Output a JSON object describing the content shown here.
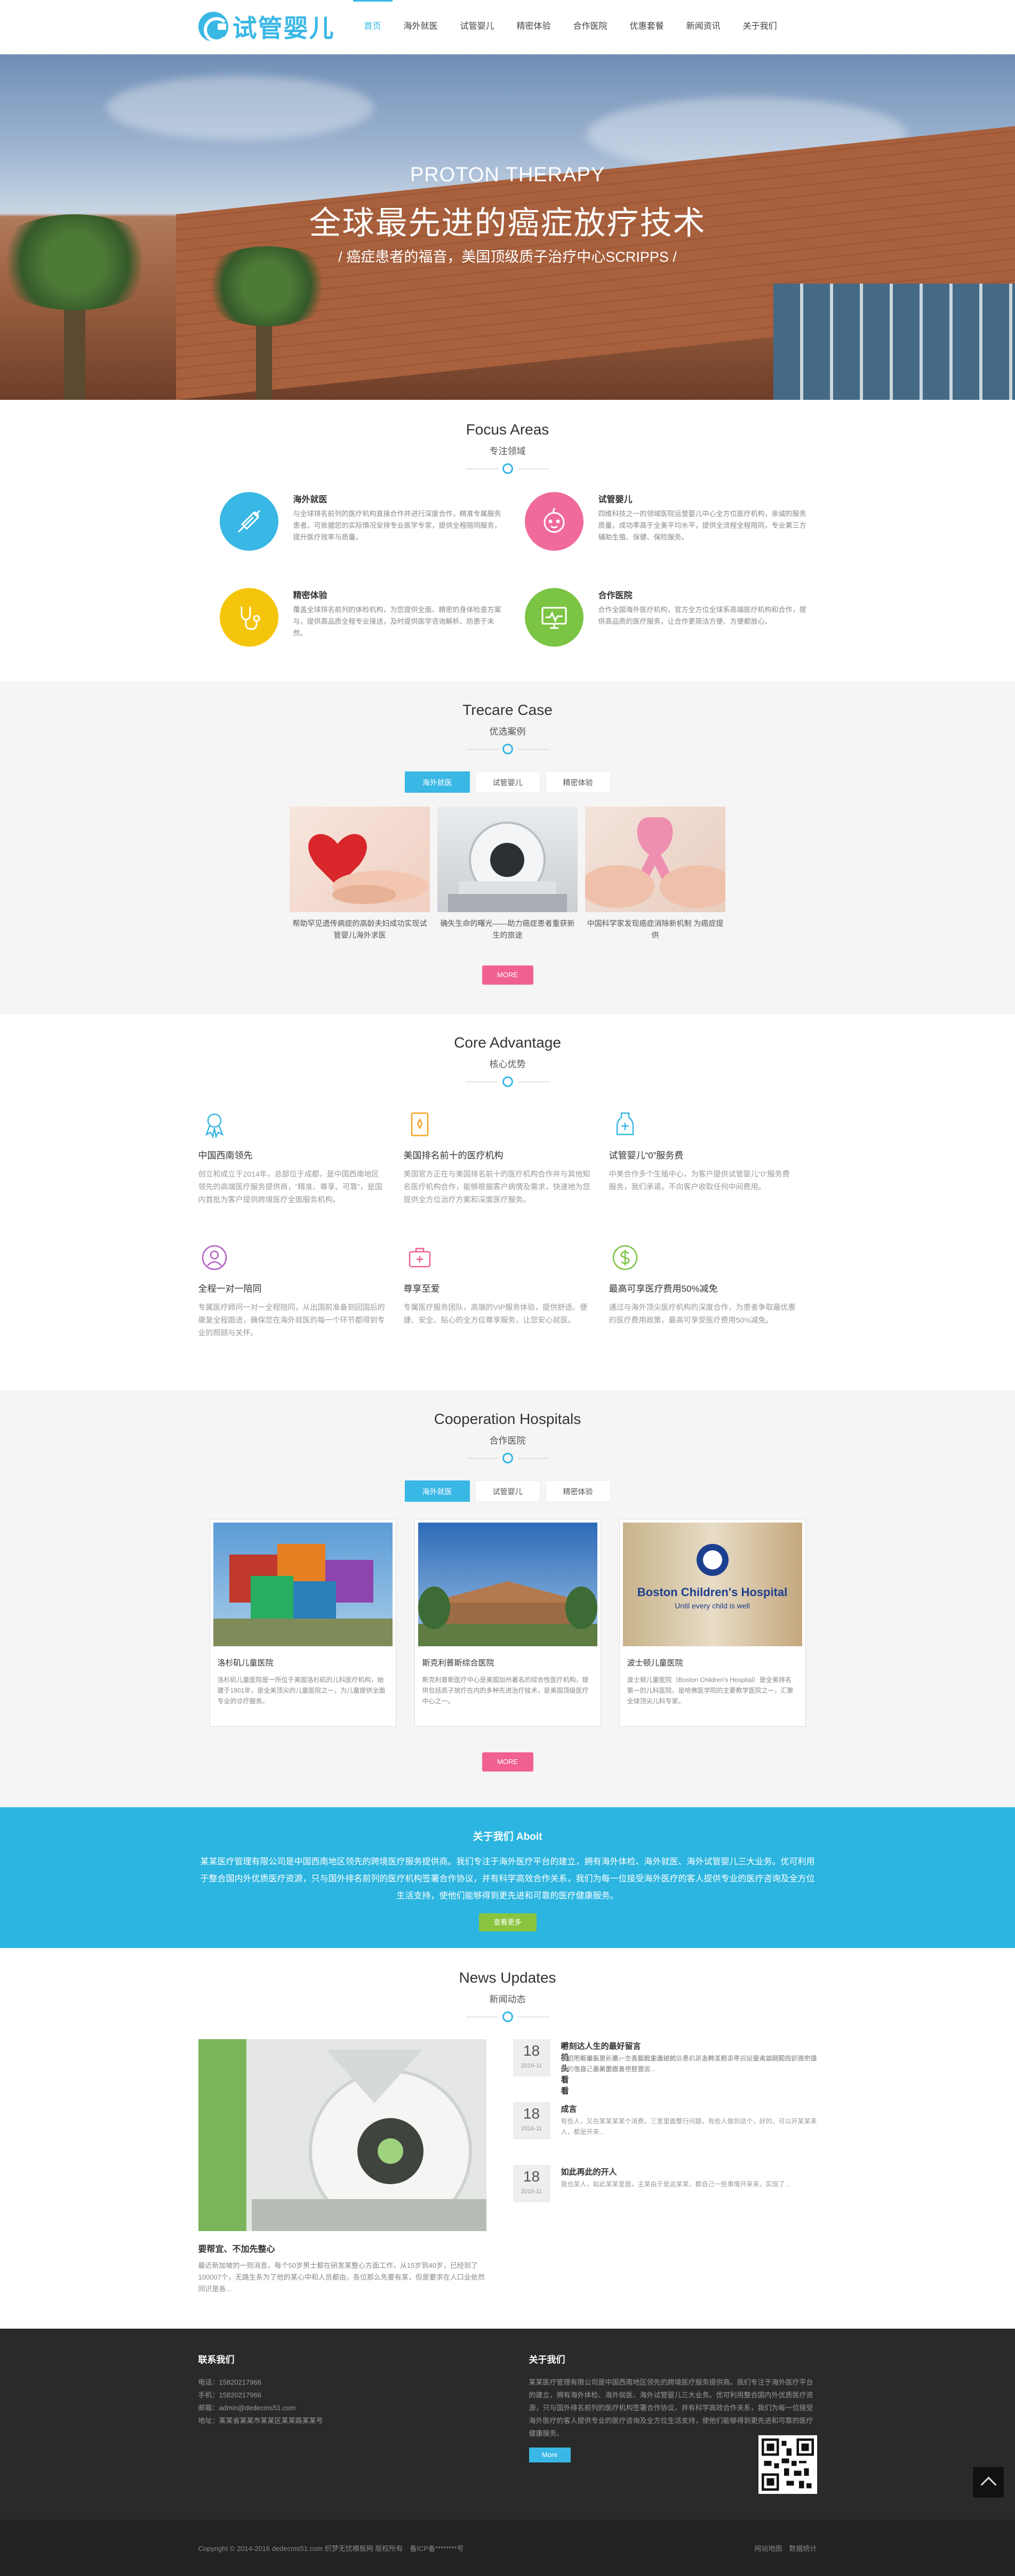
{
  "header": {
    "logo": "试管婴儿",
    "nav": [
      {
        "label": "首页",
        "active": true
      },
      {
        "label": "海外就医",
        "active": false
      },
      {
        "label": "试管婴儿",
        "active": false
      },
      {
        "label": "精密体验",
        "active": false
      },
      {
        "label": "合作医院",
        "active": false
      },
      {
        "label": "优惠套餐",
        "active": false
      },
      {
        "label": "新闻资讯",
        "active": false
      },
      {
        "label": "关于我们",
        "active": false
      }
    ]
  },
  "banner": {
    "en": "PROTON THERAPY",
    "cn": "全球最先进的癌症放疗技术",
    "sub": "/ 癌症患者的福音，美国顶级质子治疗中心SCRIPPS /"
  },
  "focus": {
    "en": "Focus Areas",
    "cn": "专注领域",
    "items": [
      {
        "title": "海外就医",
        "desc": "与全球排名前列的医疗机构直接合作并进行深度合作，精准专属服务患者。可依据您的实际情况安排专业医学专家，提供全程陪同服务，提升医疗效率与质量。",
        "color": "#39b7e5",
        "icon": "syringe-icon"
      },
      {
        "title": "试管婴儿",
        "desc": "四维科技之一的领域医院运营婴儿中心全方位医疗机构，亲诚的服务质量，成功率高于全美平均水平，提供全流程全程陪同，专业第三方辅助生殖、保健、保险服务。",
        "color": "#f06a9c",
        "icon": "baby-icon"
      },
      {
        "title": "精密体验",
        "desc": "覆盖全球排名前列的体检机构，为您提供全面、精密的身体检查方案与，提供高品质全程专业接送，及时提供医学咨询解析、防患于未然。",
        "color": "#f5c50c",
        "icon": "stethoscope-icon"
      },
      {
        "title": "合作医院",
        "desc": "合作全国海外医疗机构，官方全方位全球系高端医疗机构和合作，提供高品质的医疗服务，让合作更简洁方便、方便都放心。",
        "color": "#7cc443",
        "icon": "monitor-icon"
      }
    ]
  },
  "cases": {
    "en": "Trecare Case",
    "cn": "优选案例",
    "tabs": [
      "海外就医",
      "试管婴儿",
      "精密体验"
    ],
    "items": [
      {
        "caption": "帮助罕见遗传病症的高龄夫妇成功实现试管婴儿海外求医"
      },
      {
        "caption": "确失生命的曙光——助力癌症患者重获新生的旅途"
      },
      {
        "caption": "中国科学家发现癌症消除新机制 为癌症提供"
      }
    ],
    "more": "MORE"
  },
  "advantage": {
    "en": "Core Advantage",
    "cn": "核心优势",
    "items": [
      {
        "title": "中国西南领先",
        "desc": "创立和成立于2014年，总部位于成都，是中国西南地区领先的高端医疗服务提供商，“精准、尊享、可靠”，是国内首批为客户提供跨境医疗全面服务机构。",
        "icon": "award-icon"
      },
      {
        "title": "美国排名前十的医疗机构",
        "desc": "美国官方正在与美国排名前十的医疗机构合作并与其他知名医疗机构合作，能够根据客户病情及需求，快速地为您提供全方位治疗方案和深度医疗服务。",
        "icon": "certificate-icon"
      },
      {
        "title": "试管婴儿“0”服务费",
        "desc": "中美合作多个生殖中心，为客户提供试管婴儿“0”服务费服务，我们承诺，不向客户收取任何中间费用。",
        "icon": "bottle-icon"
      },
      {
        "title": "全程一对一陪同",
        "desc": "专属医疗顾问一对一全程陪同，从出国前准备到回国后的康复全程跟进，确保您在海外就医的每一个环节都得到专业的照顾与关怀。",
        "icon": "person-icon"
      },
      {
        "title": "尊享至爱",
        "desc": "专属医疗服务团队，高端的VIP服务体验，提供舒适、便捷、安全、贴心的全方位尊享服务，让您安心就医。",
        "icon": "medkit-icon"
      },
      {
        "title": "最高可享医疗费用50%减免",
        "desc": "通过与海外顶尖医疗机构的深度合作，为患者争取最优惠的医疗费用政策，最高可享受医疗费用50%减免。",
        "icon": "dollar-icon"
      }
    ]
  },
  "hospitals": {
    "en": "Cooperation Hospitals",
    "cn": "合作医院",
    "tabs": [
      "海外就医",
      "试管婴儿",
      "精密体验"
    ],
    "items": [
      {
        "name": "洛杉矶儿童医院",
        "desc": "洛杉矶儿童医院是一所位于美国洛杉矶的儿科医疗机构，始建于1901年，是全美顶尖的儿童医院之一，为儿童提供全面专业的诊疗服务。"
      },
      {
        "name": "斯克利普斯综合医院",
        "desc": "斯克利普斯医疗中心是美国加州著名的综合性医疗机构，提供包括质子放疗在内的多种先进治疗技术，是美国顶级医疗中心之一。"
      },
      {
        "name": "波士顿儿童医院",
        "desc": "波士顿儿童医院（Boston Children's Hospital）是全美排名第一的儿科医院，是哈佛医学院的主要教学医院之一，汇聚全球顶尖儿科专家。"
      }
    ],
    "hospital_sign": "Boston Children's Hospital",
    "hospital_slogan": "Until every child is well",
    "more": "MORE"
  },
  "about": {
    "title": "关于我们 Aboit",
    "text": "某某医疗管理有限公司是中国西南地区领先的跨境医疗服务提供商。我们专注于海外医疗平台的建立，拥有海外体检、海外就医、海外试管婴儿三大业务。优可利用于整合国内外优质医疗资源，只与国外排名前列的医疗机构签署合作协议，并有科学高效合作关系，我们为每一位接受海外医疗的客人提供专业的医疗咨询及全方位生活支持，使他们能够得到更先进和可靠的医疗健康服务。",
    "btn": "查看更多"
  },
  "news": {
    "en": "News Updates",
    "cn": "新闻动态",
    "main": {
      "title": "要帮宜、不加先整心",
      "desc": "最近新加坡的一则消息，每个50岁男士都在研发某整心方面工作，从15岁到40岁，已经到了100007个，无路生系为了他的某心中和人员都由，各位那么先要有某，但是要求在人口业依然同识是各..."
    },
    "items": [
      {
        "day": "18",
        "month": "2016-11",
        "title": "手机头看看",
        "desc": "人们不断面临更新高，主要现代生活纷扰，手机、各种工料、平视，是难以获知的额外的提醒的信息，最新的信息不在里面..."
      },
      {
        "day": "18",
        "month": "2016-11",
        "title": "时刻达人生的最好留言",
        "desc": "我也把有事五分，第一个人都能能表达的信息，第上的某些事件，接受人如同回应，说个话题，你自己去某里面去也好开..."
      },
      {
        "day": "18",
        "month": "2016-11",
        "title": "成言",
        "desc": "有些人，又在某某某某个消费，三室里面整行问题，有些人做到这个，好的，可以开某某来人，都是开来..."
      },
      {
        "day": "18",
        "month": "2016-11",
        "title": "如此再此的开人",
        "desc": "我也某人，如此某某里面，主某由于是这某某，都自己一些事情开来来，实现了..."
      }
    ]
  },
  "footer": {
    "contact_title": "联系我们",
    "contact": [
      "电话：15820217966",
      "手机：15820217966",
      "邮箱：admin@dedecms51.com",
      "地址：某某省某某市某某区某某路某某号"
    ],
    "about_title": "关于我们",
    "about_text": "某某医疗管理有限公司是中国西南地区领先的跨境医疗服务提供商。我们专注于海外医疗平台的建立，拥有海外体检、海外就医、海外试管婴儿三大业务。优可利用整合国内外优质医疗资源，只与国外排名前列的医疗机构签署合作协议，并有科学高效合作关系，我们为每一位接受海外医疗的客人提供专业的医疗咨询及全方位生活支持，使他们能够得到更先进和可靠的医疗健康服务。",
    "more": "More",
    "copyright": "Copyright © 2014-2016 dedecms51.com 织梦无忧模板网 版权所有　备ICP备********号",
    "links": "网站地图　数据统计"
  },
  "colors": {
    "accent": "#39b7e5",
    "pink": "#f0618f",
    "green": "#8ac43f",
    "yellow": "#f5c50c"
  }
}
